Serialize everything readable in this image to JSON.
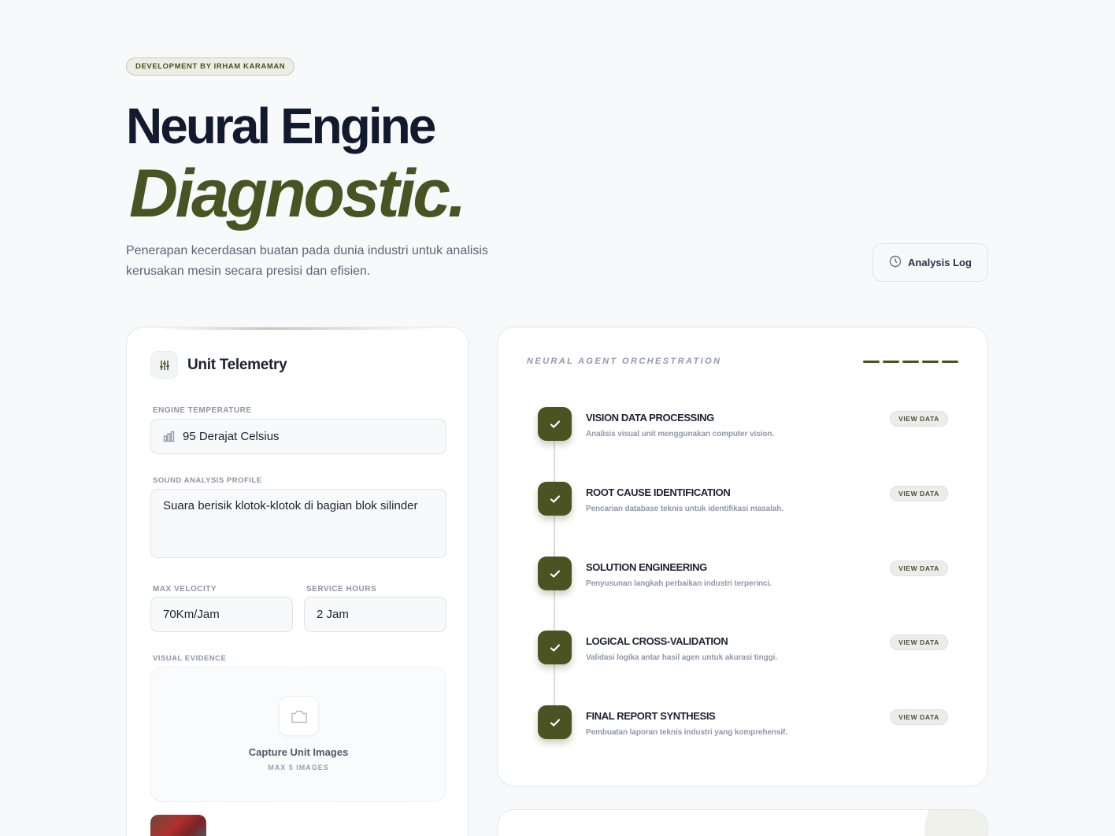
{
  "header": {
    "badge": "DEVELOPMENT BY IRHAM KARAMAN",
    "title_line1": "Neural Engine",
    "title_line2": "Diagnostic.",
    "subtitle": "Penerapan kecerdasan buatan pada dunia industri untuk analisis kerusakan mesin secara presisi dan efisien.",
    "log_button": "Analysis Log",
    "log_icon": "clock-icon"
  },
  "telemetry": {
    "title": "Unit Telemetry",
    "icon": "sliders-icon",
    "engine_temp_label": "ENGINE TEMPERATURE",
    "engine_temp_value": "95 Derajat Celsius",
    "engine_temp_icon": "bar-chart-icon",
    "sound_label": "SOUND ANALYSIS PROFILE",
    "sound_value": "Suara berisik klotok-klotok di bagian blok silinder",
    "velocity_label": "MAX VELOCITY",
    "velocity_value": "70Km/Jam",
    "hours_label": "SERVICE HOURS",
    "hours_value": "2 Jam",
    "evidence_label": "VISUAL EVIDENCE",
    "capture_label": "Capture Unit Images",
    "capture_limit": "MAX 5 IMAGES",
    "capture_icon": "camera-icon"
  },
  "orchestration": {
    "title": "NEURAL AGENT ORCHESTRATION",
    "view_label": "VIEW DATA",
    "accent": "#4b5323",
    "steps": [
      {
        "title": "VISION DATA PROCESSING",
        "desc": "Analisis visual unit menggunakan computer vision."
      },
      {
        "title": "ROOT CAUSE IDENTIFICATION",
        "desc": "Pencarian database teknis untuk identifikasi masalah."
      },
      {
        "title": "SOLUTION ENGINEERING",
        "desc": "Penyusunan langkah perbaikan industri terperinci."
      },
      {
        "title": "LOGICAL CROSS-VALIDATION",
        "desc": "Validasi logika antar hasil agen untuk akurasi tinggi."
      },
      {
        "title": "FINAL REPORT SYNTHESIS",
        "desc": "Pembuatan laporan teknis industri yang komprehensif."
      }
    ]
  }
}
